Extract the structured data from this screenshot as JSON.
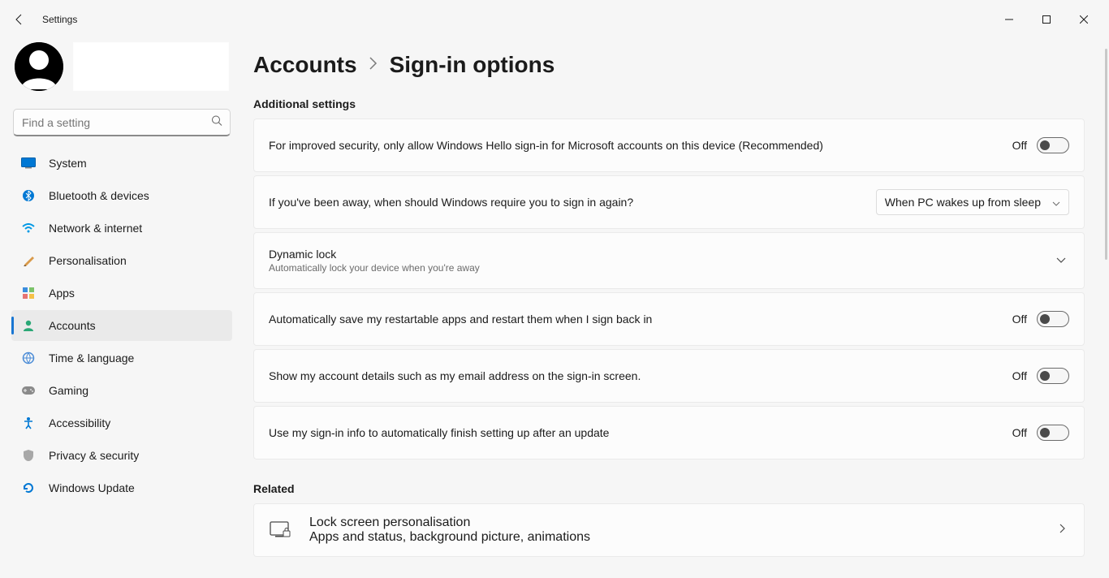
{
  "window": {
    "title": "Settings"
  },
  "search": {
    "placeholder": "Find a setting"
  },
  "sidebar": {
    "items": [
      {
        "label": "System"
      },
      {
        "label": "Bluetooth & devices"
      },
      {
        "label": "Network & internet"
      },
      {
        "label": "Personalisation"
      },
      {
        "label": "Apps"
      },
      {
        "label": "Accounts"
      },
      {
        "label": "Time & language"
      },
      {
        "label": "Gaming"
      },
      {
        "label": "Accessibility"
      },
      {
        "label": "Privacy & security"
      },
      {
        "label": "Windows Update"
      }
    ]
  },
  "breadcrumb": {
    "parent": "Accounts",
    "current": "Sign-in options"
  },
  "sections": {
    "additional": "Additional settings",
    "related": "Related"
  },
  "settings": {
    "hello": {
      "label": "For improved security, only allow Windows Hello sign-in for Microsoft accounts on this device (Recommended)",
      "state": "Off"
    },
    "away": {
      "label": "If you've been away, when should Windows require you to sign in again?",
      "value": "When PC wakes up from sleep"
    },
    "dynamiclock": {
      "title": "Dynamic lock",
      "sub": "Automatically lock your device when you're away"
    },
    "restartable": {
      "label": "Automatically save my restartable apps and restart them when I sign back in",
      "state": "Off"
    },
    "details": {
      "label": "Show my account details such as my email address on the sign-in screen.",
      "state": "Off"
    },
    "finishsetup": {
      "label": "Use my sign-in info to automatically finish setting up after an update",
      "state": "Off"
    }
  },
  "related": {
    "lockscreen": {
      "title": "Lock screen personalisation",
      "sub": "Apps and status, background picture, animations"
    }
  }
}
